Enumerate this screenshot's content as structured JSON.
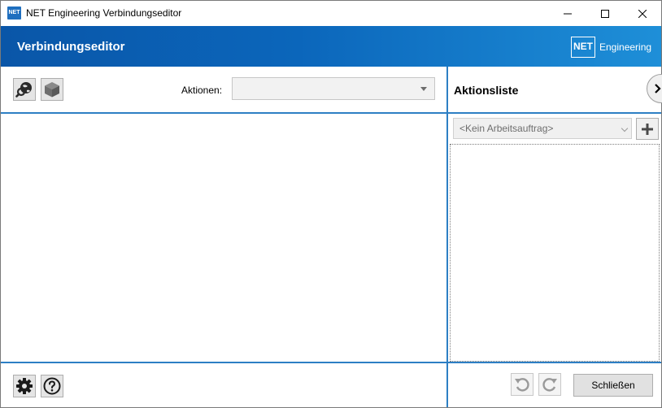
{
  "window": {
    "icon_text": "NET",
    "title": "NET Engineering Verbindungseditor"
  },
  "header": {
    "title": "Verbindungseditor",
    "brand_box": "NET",
    "brand_text": "Engineering"
  },
  "toolbar": {
    "icons": [
      "globe-search-icon",
      "cube-icon"
    ],
    "actions_label": "Aktionen:",
    "actions_value": ""
  },
  "footer_left": {
    "icons": [
      "gear-icon",
      "help-icon"
    ]
  },
  "right_panel": {
    "title": "Aktionsliste",
    "work_order_placeholder": "<Kein Arbeitsauftrag>",
    "undo_icon": "undo-icon",
    "redo_icon": "redo-icon",
    "close_label": "Schließen"
  },
  "colors": {
    "header_start": "#0a56a8",
    "header_end": "#1e8fd8",
    "divider": "#2d7fc4"
  }
}
